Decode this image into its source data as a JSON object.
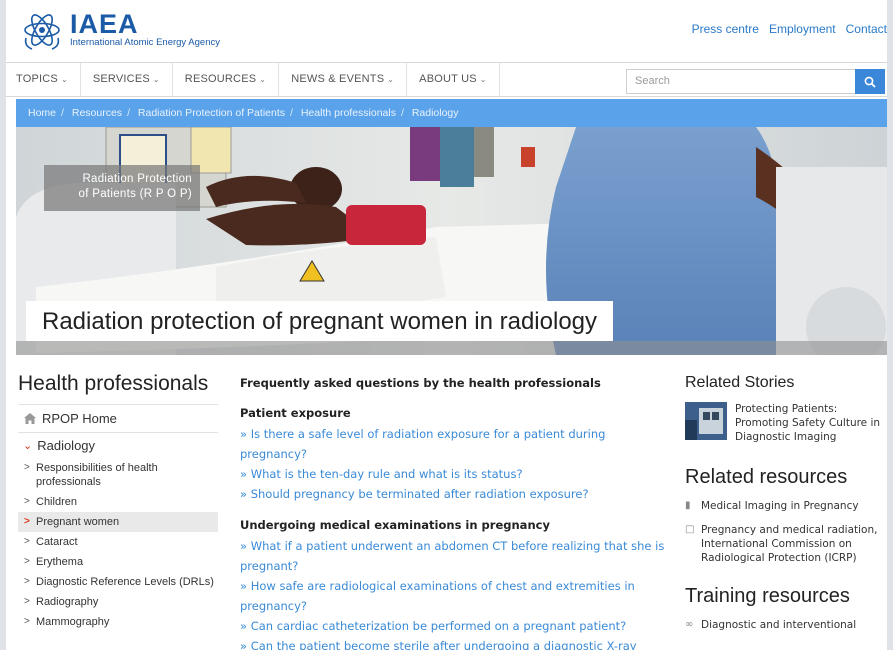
{
  "header": {
    "logo_acronym": "IAEA",
    "logo_full": "International Atomic Energy Agency",
    "top_links": [
      "Press centre",
      "Employment",
      "Contact"
    ]
  },
  "nav": {
    "items": [
      "TOPICS",
      "SERVICES",
      "RESOURCES",
      "NEWS & EVENTS",
      "ABOUT US"
    ],
    "search_placeholder": "Search"
  },
  "breadcrumb": [
    "Home",
    "Resources",
    "Radiation Protection of Patients",
    "Health professionals",
    "Radiology"
  ],
  "hero": {
    "tag_line1": "Radiation Protection",
    "tag_line2": "of Patients (R P O P)",
    "title": "Radiation protection of pregnant women in radiology"
  },
  "sidebar": {
    "title": "Health professionals",
    "home": "RPOP Home",
    "section": "Radiology",
    "items": [
      "Responsibilities of health professionals",
      "Children",
      "Pregnant women",
      "Cataract",
      "Erythema",
      "Diagnostic Reference Levels (DRLs)",
      "Radiography",
      "Mammography"
    ],
    "active_index": 2
  },
  "main": {
    "heading": "Frequently asked questions by the health professionals",
    "sections": [
      {
        "title": "Patient exposure",
        "questions": [
          "Is there a safe level of radiation exposure for a patient during pregnancy?",
          "What is the ten-day rule and what is its status?",
          "Should pregnancy be terminated after radiation exposure?"
        ]
      },
      {
        "title": "Undergoing medical examinations in pregnancy",
        "questions": [
          "What if a patient underwent an abdomen CT before realizing that she is pregnant?",
          "How safe are radiological examinations of chest and extremities in pregnancy?",
          "Can cardiac catheterization be performed on a pregnant patient?",
          "Can the patient become sterile after undergoing a diagnostic X-ray"
        ]
      }
    ]
  },
  "right": {
    "related_stories_title": "Related Stories",
    "story_text": "Protecting Patients: Promoting Safety Culture in Diagnostic Imaging",
    "related_resources_title": "Related resources",
    "resources": [
      {
        "icon": "video-icon",
        "text": "Medical Imaging in Pregnancy"
      },
      {
        "icon": "document-icon",
        "text": "Pregnancy and medical radiation, International Commission on Radiological Protection (ICRP)"
      }
    ],
    "training_title": "Training resources",
    "training": [
      {
        "icon": "link-icon",
        "text": "Diagnostic and interventional"
      }
    ]
  },
  "colors": {
    "brand_blue": "#1a5aa6",
    "link_blue": "#2a7ac9",
    "breadcrumb_bg": "#5aa2ea",
    "active_marker": "#d9371d"
  }
}
